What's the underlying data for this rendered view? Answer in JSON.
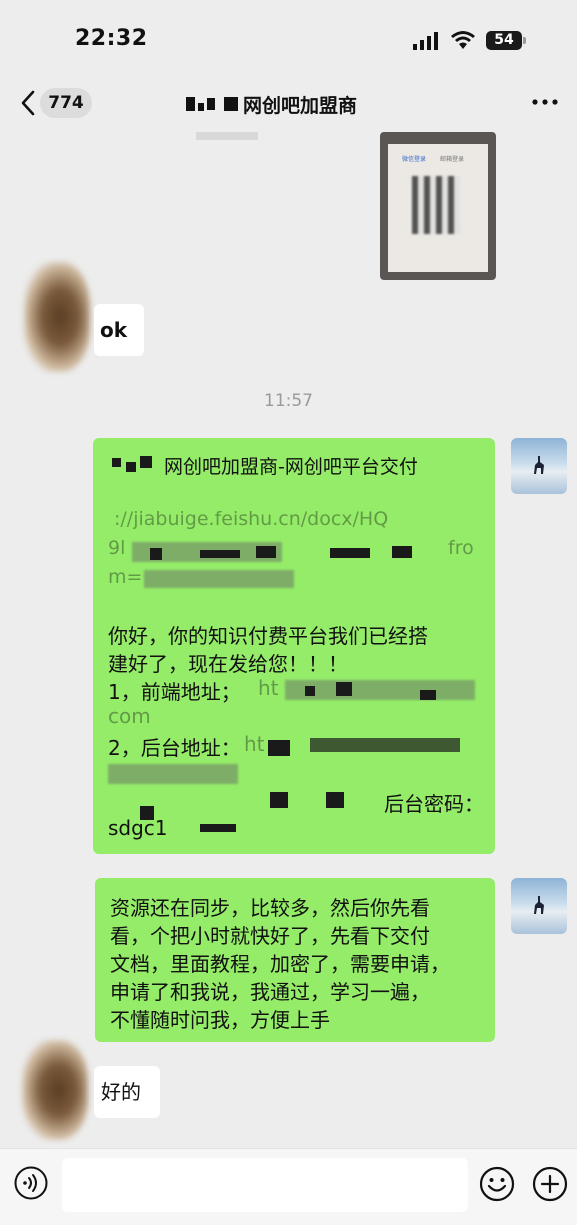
{
  "status_bar": {
    "time": "22:32",
    "battery": "54"
  },
  "nav": {
    "unread_count": "774",
    "title": "网创吧加盟商"
  },
  "image_message": {
    "tab1": "微信登录",
    "tab2": "邮箱登录"
  },
  "messages": {
    "ok": "ok",
    "timestamp": "11:57",
    "delivery": {
      "line1": "网创吧加盟商-网创吧平台交付",
      "link_a": "://jiabuige.feishu.cn/docx/HQ",
      "link_b_start": "9l",
      "link_b_end": "fro",
      "link_c": "m=",
      "greet1": "你好，你的知识付费平台我们已经搭",
      "greet2": "建好了，现在发给您！！！",
      "front_label": "1，前端地址；",
      "front_url_start": "ht",
      "front_url_end": "com",
      "admin_label": "2，后台地址：",
      "admin_url_start": "ht",
      "admin_pw_label": "后台密码：",
      "pw_start": "sdgc1"
    },
    "sync": {
      "l1": "资源还在同步，比较多，然后你先看",
      "l2": "看，个把小时就快好了，先看下交付",
      "l3": "文档，里面教程，加密了，需要申请，",
      "l4": "申请了和我说，我通过，学习一遍，",
      "l5": "不懂随时问我，方便上手"
    },
    "ok2": "好的"
  },
  "colors": {
    "bg": "#ededed",
    "green_bubble": "#95ec69",
    "white_bubble": "#ffffff"
  },
  "icons": [
    "back-icon",
    "more-icon",
    "voice-icon",
    "emoji-icon",
    "plus-icon",
    "signal-icon",
    "wifi-icon"
  ]
}
